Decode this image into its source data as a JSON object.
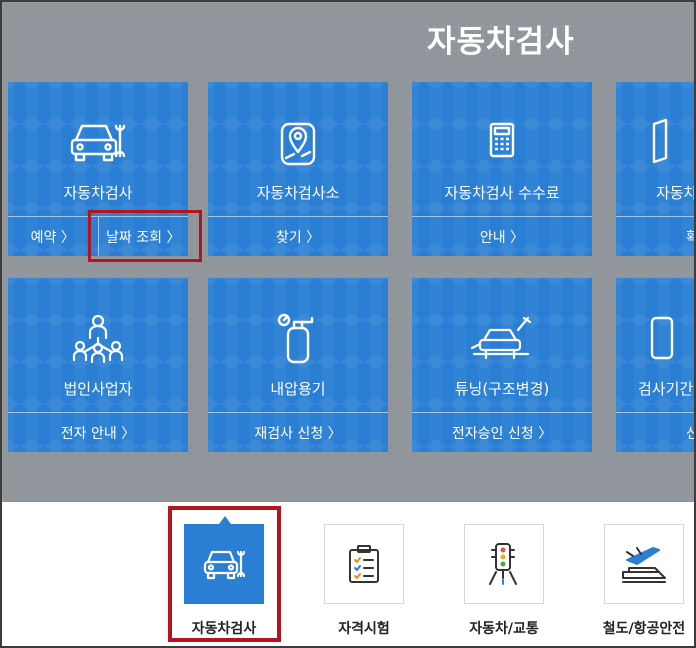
{
  "header": {
    "title": "자동차검사"
  },
  "cards": [
    {
      "label": "자동차검사",
      "icon": "car-wrench-icon",
      "links": [
        "예약 〉",
        "날짜 조회 〉"
      ]
    },
    {
      "label": "자동차검사소",
      "icon": "map-pin-icon",
      "links": [
        "찾기 〉"
      ]
    },
    {
      "label": "자동차검사 수수료",
      "icon": "calculator-icon",
      "links": [
        "안내 〉"
      ]
    },
    {
      "label": "자동차검",
      "icon": "document-icon",
      "links": [
        "확"
      ]
    },
    {
      "label": "법인사업자",
      "icon": "organization-icon",
      "links": [
        "전자 안내 〉"
      ]
    },
    {
      "label": "내압용기",
      "icon": "gas-cylinder-icon",
      "links": [
        "재검사 신청 〉"
      ]
    },
    {
      "label": "튜닝(구조변경)",
      "icon": "car-tuning-icon",
      "links": [
        "전자승인 신청 〉"
      ]
    },
    {
      "label": "검사기간",
      "icon": "phone-icon",
      "links": [
        "신"
      ]
    }
  ],
  "bottom_nav": [
    {
      "label": "자동차검사",
      "icon": "car-wrench-icon",
      "active": true
    },
    {
      "label": "자격시험",
      "icon": "checklist-icon",
      "active": false
    },
    {
      "label": "자동차/교통",
      "icon": "traffic-light-icon",
      "active": false
    },
    {
      "label": "철도/항공안전",
      "icon": "plane-train-icon",
      "active": false
    }
  ],
  "colors": {
    "card_blue": "#2a7fd4",
    "overlay_gray": "#8f959a",
    "highlight_red": "#b3141f"
  }
}
